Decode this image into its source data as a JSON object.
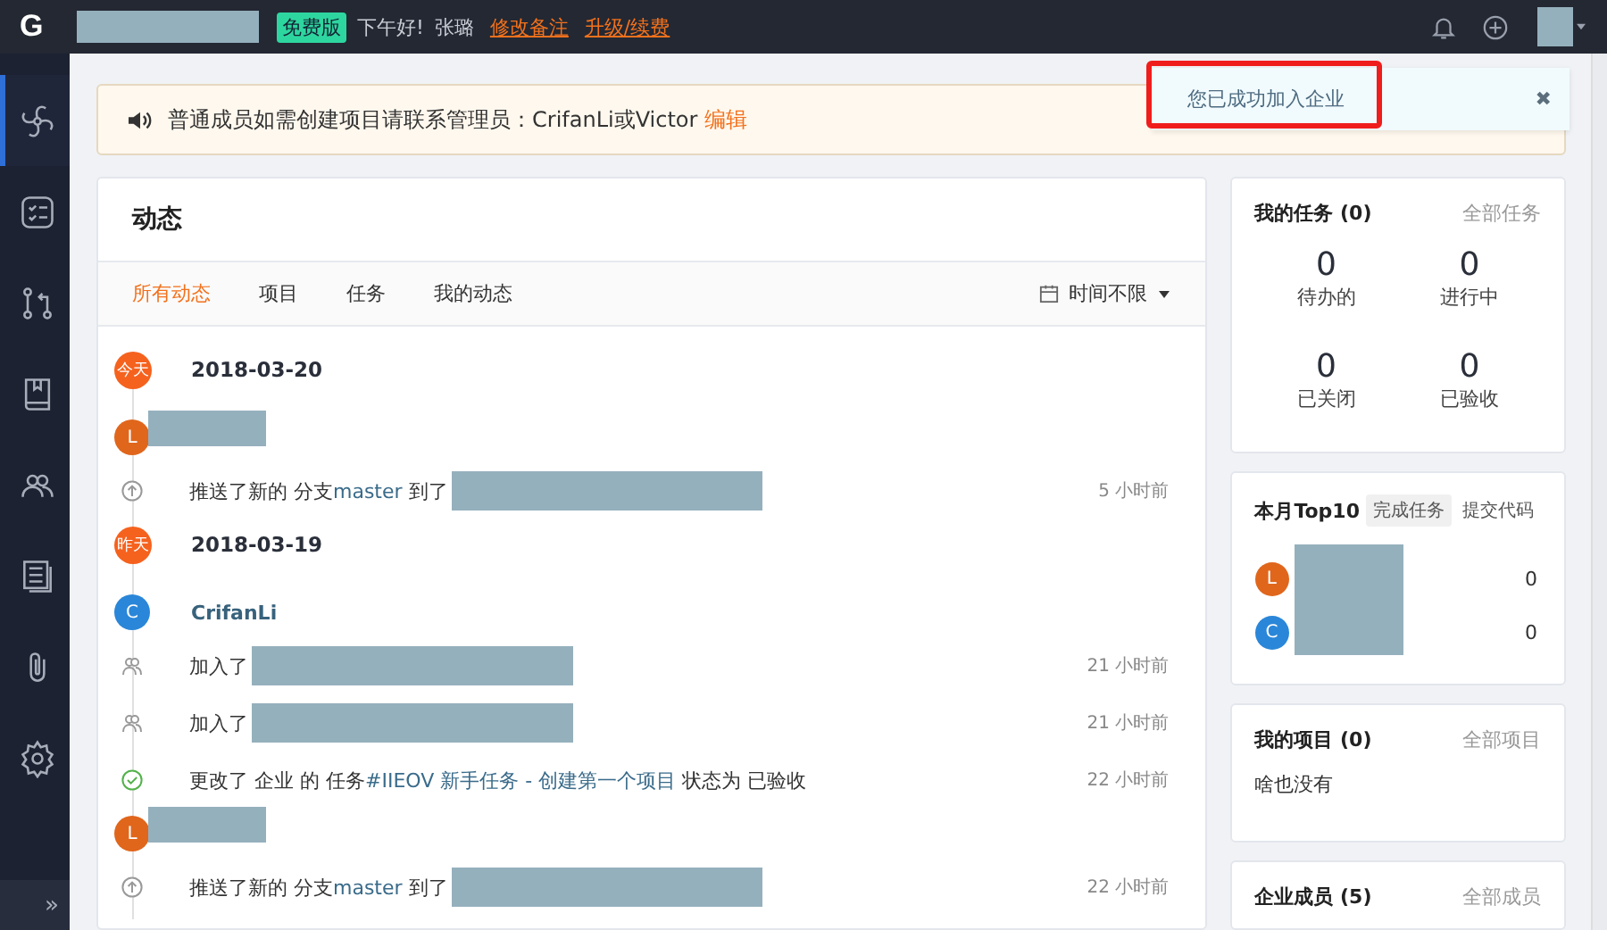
{
  "header": {
    "logo": "G",
    "plan_badge": "免费版",
    "greeting": "下午好!",
    "user": "张璐",
    "links": [
      "修改备注",
      "升级/续费"
    ]
  },
  "sidebar": {
    "items": [
      {
        "kind": "fan",
        "selected": true
      },
      {
        "kind": "tasks",
        "selected": false
      },
      {
        "kind": "merge",
        "selected": false
      },
      {
        "kind": "book",
        "selected": false
      },
      {
        "kind": "team",
        "selected": false
      },
      {
        "kind": "docs",
        "selected": false
      },
      {
        "kind": "clip",
        "selected": false
      },
      {
        "kind": "gear",
        "selected": false
      }
    ],
    "expand": "»"
  },
  "notice": {
    "text": "普通成员如需创建项目请联系管理员：CrifanLi或Victor",
    "link": "编辑"
  },
  "toast": {
    "text": "您已成功加入企业",
    "close": "✖"
  },
  "feed": {
    "title": "动态",
    "tabs": [
      {
        "label": "所有动态",
        "selected": true
      },
      {
        "label": "项目",
        "selected": false
      },
      {
        "label": "任务",
        "selected": false
      },
      {
        "label": "我的动态",
        "selected": false
      }
    ],
    "filter": "时间不限",
    "groups": [
      {
        "day": "今天",
        "date": "2018-03-20",
        "entries": [
          {
            "avatar": "L",
            "color": "#e0661c",
            "actions": [
              {
                "kind": "push",
                "pre": "推送了新的 分支",
                "link": "master",
                "post": "到了",
                "time": "5 小时前"
              }
            ]
          }
        ]
      },
      {
        "day": "昨天",
        "date": "2018-03-19",
        "entries": [
          {
            "avatar": "C",
            "color": "#2a86d8",
            "user": "CrifanLi",
            "actions": [
              {
                "kind": "join",
                "pre": "加入了",
                "time": "21 小时前"
              },
              {
                "kind": "join",
                "pre": "加入了",
                "time": "21 小时前"
              },
              {
                "kind": "done",
                "pre": "更改了 企业 的 任务",
                "link": "#IIEOV 新手任务 - 创建第一个项目",
                "post": "状态为 已验收",
                "time": "22 小时前"
              }
            ]
          },
          {
            "avatar": "L",
            "color": "#e0661c",
            "actions": [
              {
                "kind": "push",
                "pre": "推送了新的 分支",
                "link": "master",
                "post": "到了",
                "time": "22 小时前"
              }
            ]
          }
        ]
      }
    ]
  },
  "tasks": {
    "title": "我的任务 (0)",
    "link": "全部任务",
    "stats": [
      {
        "value": "0",
        "label": "待办的"
      },
      {
        "value": "0",
        "label": "进行中"
      },
      {
        "value": "0",
        "label": "已关闭"
      },
      {
        "value": "0",
        "label": "已验收"
      }
    ]
  },
  "top10": {
    "title": "本月Top10",
    "tabs": [
      {
        "label": "完成任务",
        "selected": true
      },
      {
        "label": "提交代码",
        "selected": false
      }
    ],
    "rows": [
      {
        "avatar": "L",
        "color": "#e0661c",
        "count": "0"
      },
      {
        "avatar": "C",
        "color": "#2a86d8",
        "count": "0"
      }
    ]
  },
  "projects": {
    "title": "我的项目 (0)",
    "link": "全部项目",
    "empty": "啥也没有"
  },
  "members": {
    "title": "企业成员 (5)",
    "link": "全部成员"
  }
}
